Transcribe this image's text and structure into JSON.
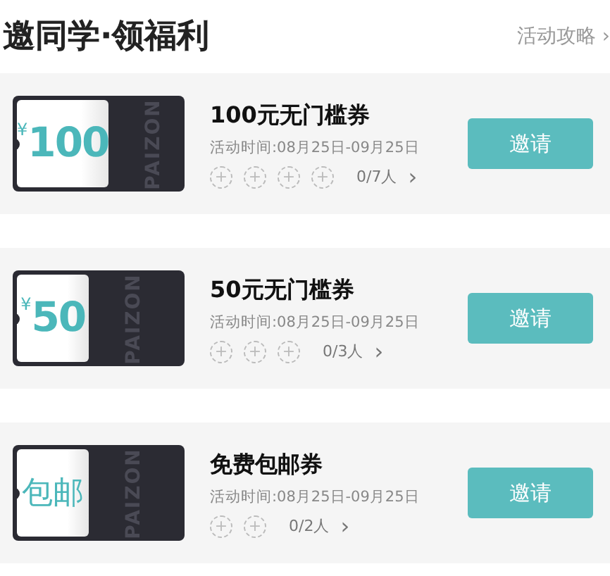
{
  "header": {
    "title": "邀同学·领福利",
    "link": "活动攻略",
    "link_chevron": "›"
  },
  "coupons": [
    {
      "ticket": {
        "currency": "¥",
        "amount": "100",
        "brand": "PAIZON"
      },
      "title": "100元无门槛券",
      "period": "活动时间:08月25日-09月25日",
      "slots": [
        "+",
        "+",
        "+",
        "+"
      ],
      "progress": "0/7人",
      "chevron": "›",
      "button": "邀请"
    },
    {
      "ticket": {
        "currency": "¥",
        "amount": "50",
        "brand": "PAIZON"
      },
      "title": "50元无门槛券",
      "period": "活动时间:08月25日-09月25日",
      "slots": [
        "+",
        "+",
        "+"
      ],
      "progress": "0/3人",
      "chevron": "›",
      "button": "邀请"
    },
    {
      "ticket": {
        "amount": "包邮",
        "brand": "PAIZON"
      },
      "title": "免费包邮券",
      "period": "活动时间:08月25日-09月25日",
      "slots": [
        "+",
        "+"
      ],
      "progress": "0/2人",
      "chevron": "›",
      "button": "邀请"
    }
  ]
}
